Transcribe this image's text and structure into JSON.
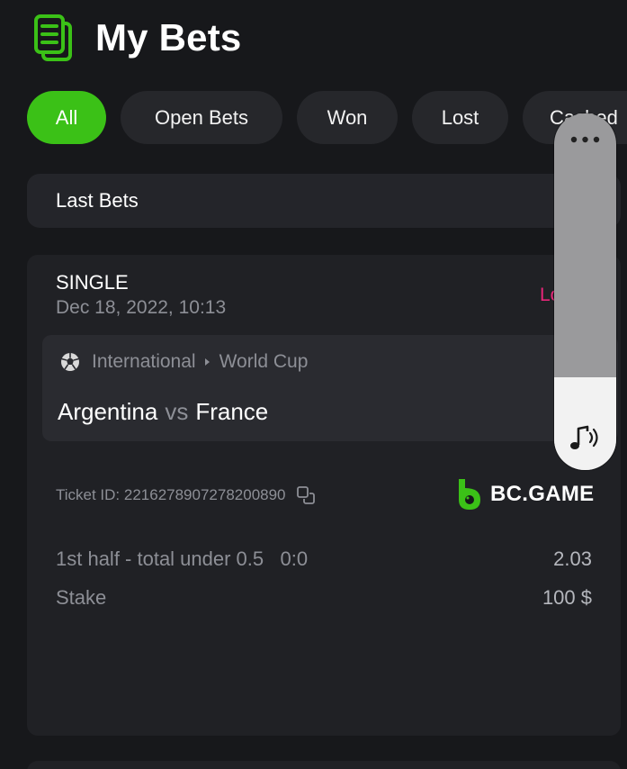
{
  "header": {
    "title": "My Bets",
    "icon": "bets-list-icon"
  },
  "tabs": [
    {
      "label": "All",
      "active": true
    },
    {
      "label": "Open Bets",
      "active": false
    },
    {
      "label": "Won",
      "active": false
    },
    {
      "label": "Lost",
      "active": false
    },
    {
      "label": "Cashed",
      "active": false
    }
  ],
  "filter": {
    "label": "Last Bets"
  },
  "bet": {
    "type": "SINGLE",
    "date": "Dec 18, 2022, 10:13",
    "status": "Lost",
    "category": "International",
    "tournament": "World Cup",
    "home_team": "Argentina",
    "vs": "vs",
    "away_team": "France",
    "ticket_label": "Ticket ID: 2216278907278200890",
    "brand": "BC.GAME",
    "market": "1st half - total under 0.5",
    "score": "0:0",
    "odds": "2.03",
    "stake_label": "Stake",
    "stake_value": "100 $"
  },
  "volume_overlay": {
    "level": 0.26
  },
  "colors": {
    "background": "#17181b",
    "accent_green": "#3bc117",
    "lost_pink": "#e9267a",
    "card": "#202125"
  }
}
